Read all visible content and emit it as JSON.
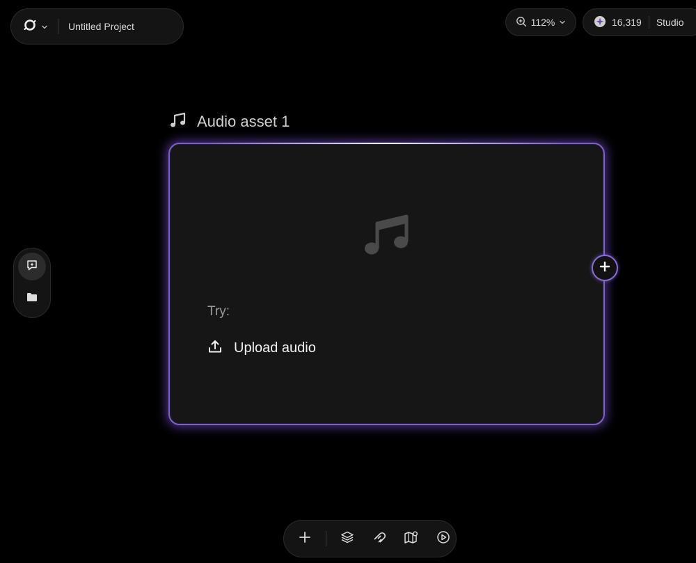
{
  "header": {
    "logo_icon": "ring-logo-icon",
    "project_title": "Untitled Project",
    "zoom": "112%",
    "credits": "16,319",
    "plan": "Studio"
  },
  "left_toolbar": {
    "items": [
      {
        "icon": "chat-sparkle-icon",
        "active": true
      },
      {
        "icon": "folder-icon",
        "active": false
      }
    ]
  },
  "node": {
    "title": "Audio asset 1",
    "icon": "music-note-icon",
    "try_label": "Try:",
    "action_label": "Upload audio",
    "action_icon": "upload-icon"
  },
  "bottom_toolbar": {
    "items": [
      "plus-icon",
      "layers-icon",
      "magnet-icon",
      "map-icon",
      "play-icon"
    ]
  },
  "colors": {
    "accent": "#7e5fd0",
    "background": "#000000",
    "card": "#161616"
  }
}
